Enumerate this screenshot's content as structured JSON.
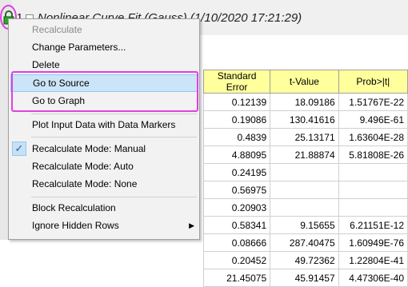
{
  "window": {
    "tree_number": "1",
    "title": "Nonlinear Curve Fit (Gauss) (1/10/2020 17:21:29)"
  },
  "table": {
    "headers": [
      "Standard Error",
      "t-Value",
      "Prob>|t|"
    ],
    "rows": [
      [
        "0.12139",
        "18.09186",
        "1.51767E-22"
      ],
      [
        "0.19086",
        "130.41616",
        "9.496E-61"
      ],
      [
        "0.4839",
        "25.13171",
        "1.63604E-28"
      ],
      [
        "4.88095",
        "21.88874",
        "5.81808E-26"
      ],
      [
        "0.24195",
        "",
        ""
      ],
      [
        "0.56975",
        "",
        ""
      ],
      [
        "0.20903",
        "",
        ""
      ],
      [
        "0.58341",
        "9.15655",
        "6.21151E-12"
      ],
      [
        "0.08666",
        "287.40475",
        "1.60949E-76"
      ],
      [
        "0.20452",
        "49.72362",
        "1.22804E-41"
      ],
      [
        "21.45075",
        "45.91457",
        "4.47306E-40"
      ]
    ]
  },
  "menu": {
    "recalculate": "Recalculate",
    "change_parameters": "Change Parameters...",
    "delete": "Delete",
    "go_to_source": "Go to Source",
    "go_to_graph": "Go to Graph",
    "plot_input": "Plot Input Data with Data Markers",
    "mode_manual": "Recalculate Mode: Manual",
    "mode_auto": "Recalculate Mode: Auto",
    "mode_none": "Recalculate Mode: None",
    "block": "Block Recalculation",
    "ignore_hidden": "Ignore Hidden Rows",
    "checkmark": "✓",
    "submenu_arrow": "▶"
  },
  "colors": {
    "highlight": "#e040e0",
    "header_bg": "#ffff9c",
    "hover_bg": "#cce4f7",
    "lock_green": "#2aa82a"
  }
}
